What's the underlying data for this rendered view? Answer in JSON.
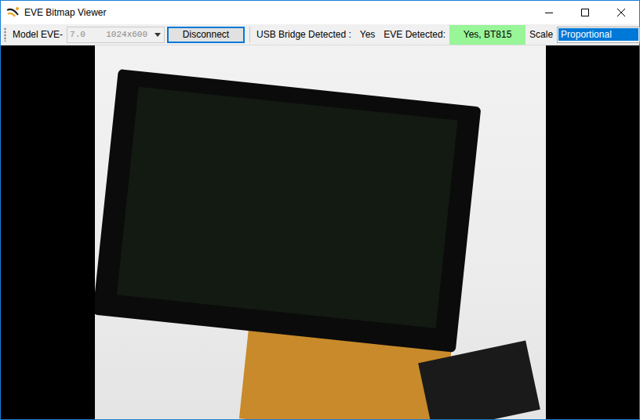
{
  "window": {
    "title": "EVE Bitmap Viewer"
  },
  "toolbar": {
    "model_label": "Model EVE-",
    "model_select": {
      "value": "7.0    1024x600",
      "disabled": true
    },
    "connect_button": "Disconnect",
    "usb_label": "USB Bridge Detected :",
    "usb_value": "Yes",
    "eve_label": "EVE Detected:",
    "eve_value": {
      "text": "Yes, BT815",
      "detected": true
    },
    "scale_label": "Scale",
    "scale_select": {
      "value": "Proportional",
      "selected": true
    }
  }
}
